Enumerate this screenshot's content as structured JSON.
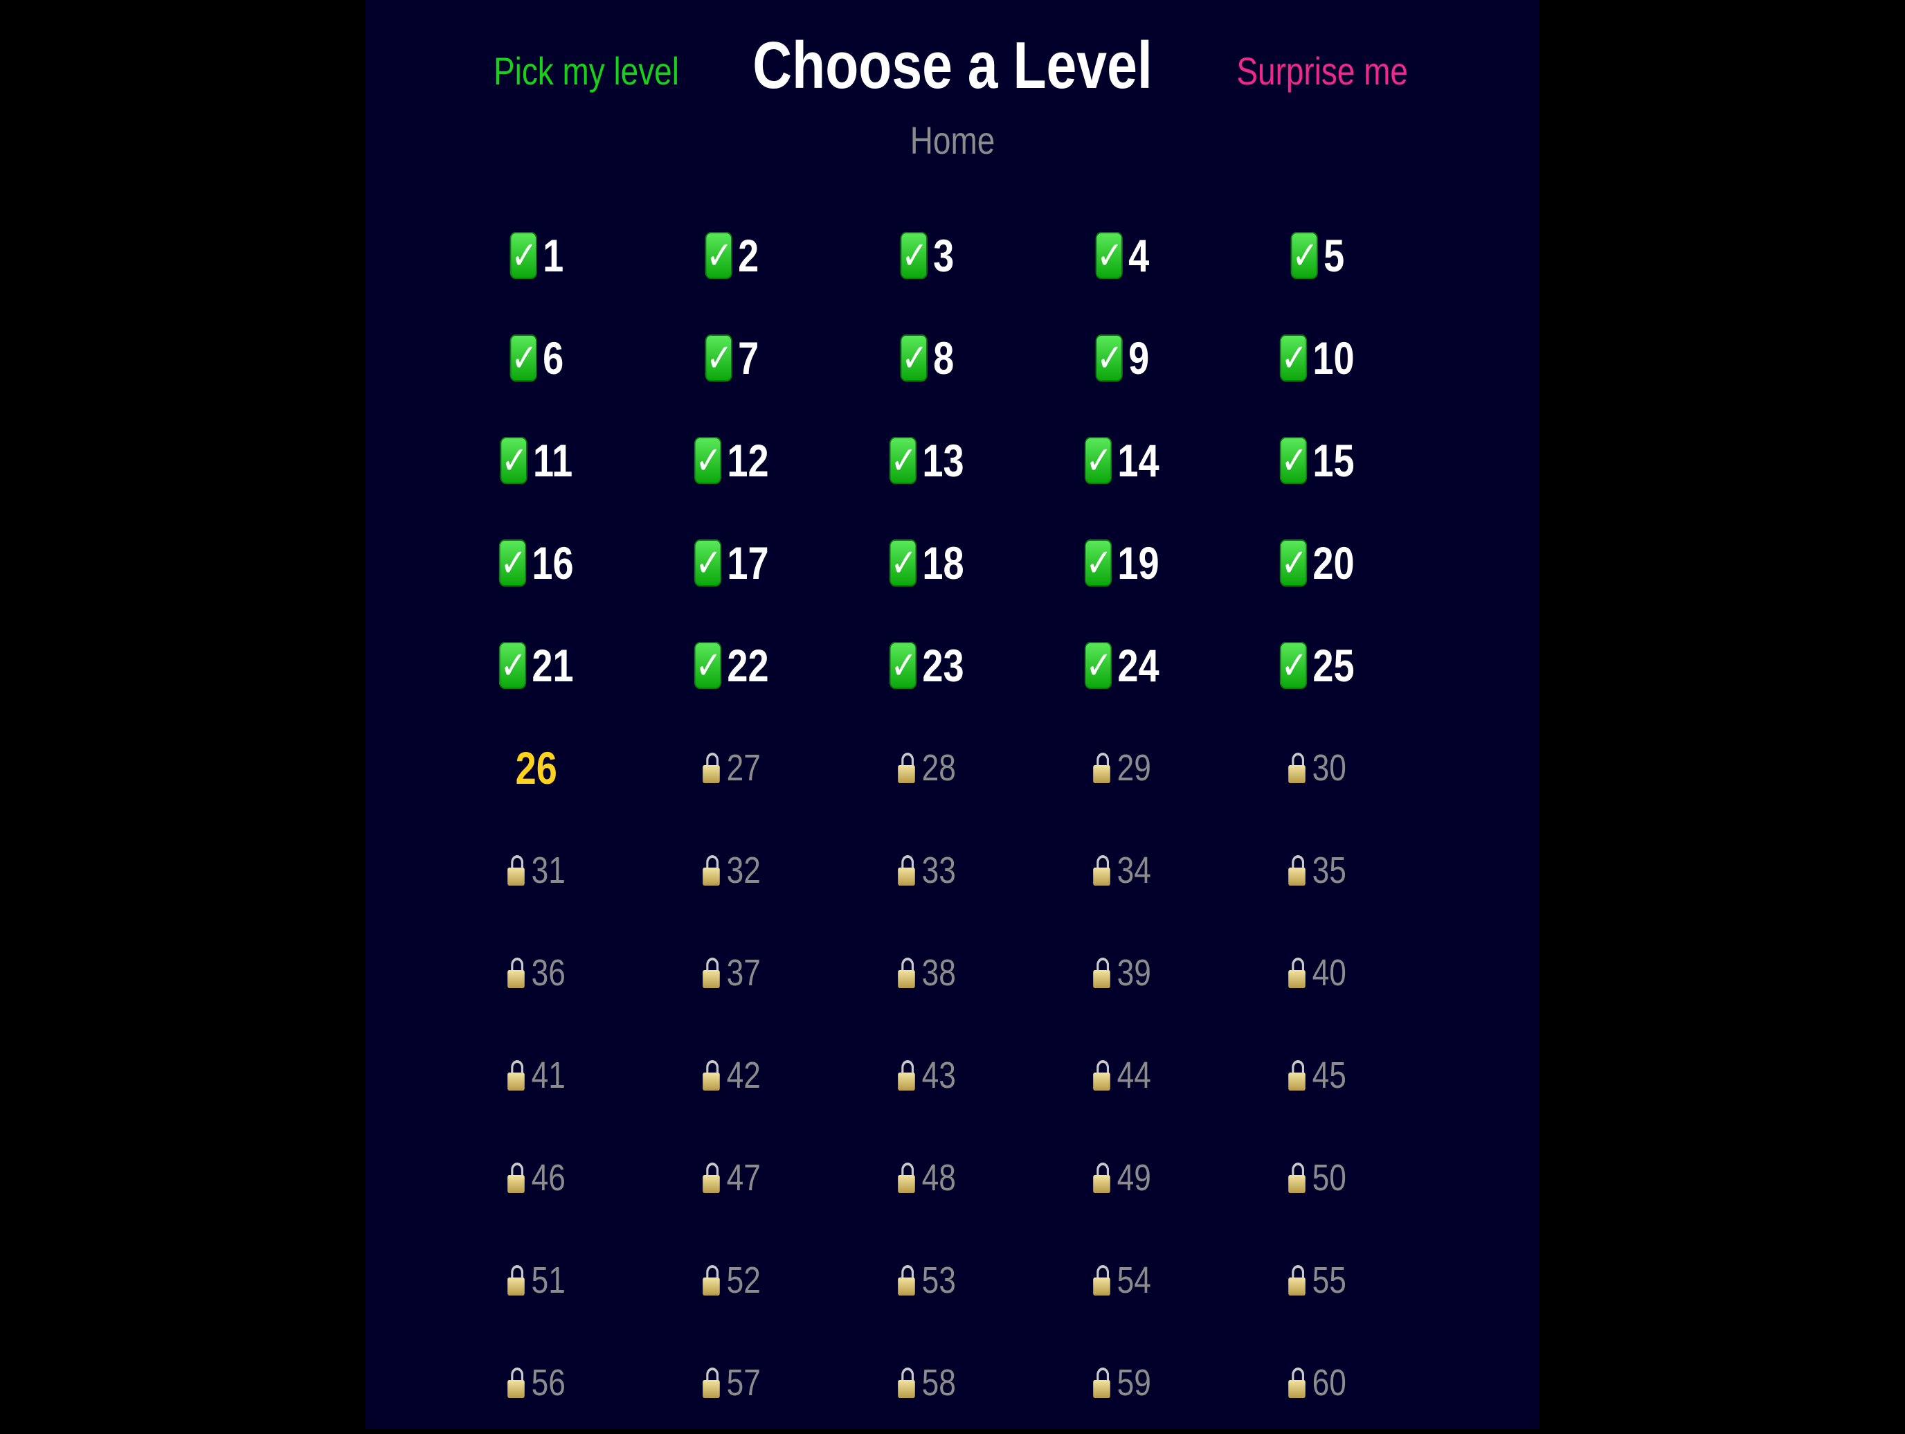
{
  "header": {
    "pick_label": "Pick my level",
    "title": "Choose a Level",
    "surprise_label": "Surprise me",
    "home_label": "Home"
  },
  "colors": {
    "background": "#000000",
    "panel": "#00002a",
    "pick": "#1ad11a",
    "surprise": "#f0288c",
    "title": "#ffffff",
    "home": "#8c8c8c",
    "current_level": "#ffd21e",
    "locked_level": "#8c8c8c"
  },
  "icons": {
    "completed": "check-mark-button-icon",
    "locked": "lock-icon"
  },
  "completed_glyph": "✓",
  "levels": [
    {
      "number": "1",
      "status": "completed"
    },
    {
      "number": "2",
      "status": "completed"
    },
    {
      "number": "3",
      "status": "completed"
    },
    {
      "number": "4",
      "status": "completed"
    },
    {
      "number": "5",
      "status": "completed"
    },
    {
      "number": "6",
      "status": "completed"
    },
    {
      "number": "7",
      "status": "completed"
    },
    {
      "number": "8",
      "status": "completed"
    },
    {
      "number": "9",
      "status": "completed"
    },
    {
      "number": "10",
      "status": "completed"
    },
    {
      "number": "11",
      "status": "completed"
    },
    {
      "number": "12",
      "status": "completed"
    },
    {
      "number": "13",
      "status": "completed"
    },
    {
      "number": "14",
      "status": "completed"
    },
    {
      "number": "15",
      "status": "completed"
    },
    {
      "number": "16",
      "status": "completed"
    },
    {
      "number": "17",
      "status": "completed"
    },
    {
      "number": "18",
      "status": "completed"
    },
    {
      "number": "19",
      "status": "completed"
    },
    {
      "number": "20",
      "status": "completed"
    },
    {
      "number": "21",
      "status": "completed"
    },
    {
      "number": "22",
      "status": "completed"
    },
    {
      "number": "23",
      "status": "completed"
    },
    {
      "number": "24",
      "status": "completed"
    },
    {
      "number": "25",
      "status": "completed"
    },
    {
      "number": "26",
      "status": "current"
    },
    {
      "number": "27",
      "status": "locked"
    },
    {
      "number": "28",
      "status": "locked"
    },
    {
      "number": "29",
      "status": "locked"
    },
    {
      "number": "30",
      "status": "locked"
    },
    {
      "number": "31",
      "status": "locked"
    },
    {
      "number": "32",
      "status": "locked"
    },
    {
      "number": "33",
      "status": "locked"
    },
    {
      "number": "34",
      "status": "locked"
    },
    {
      "number": "35",
      "status": "locked"
    },
    {
      "number": "36",
      "status": "locked"
    },
    {
      "number": "37",
      "status": "locked"
    },
    {
      "number": "38",
      "status": "locked"
    },
    {
      "number": "39",
      "status": "locked"
    },
    {
      "number": "40",
      "status": "locked"
    },
    {
      "number": "41",
      "status": "locked"
    },
    {
      "number": "42",
      "status": "locked"
    },
    {
      "number": "43",
      "status": "locked"
    },
    {
      "number": "44",
      "status": "locked"
    },
    {
      "number": "45",
      "status": "locked"
    },
    {
      "number": "46",
      "status": "locked"
    },
    {
      "number": "47",
      "status": "locked"
    },
    {
      "number": "48",
      "status": "locked"
    },
    {
      "number": "49",
      "status": "locked"
    },
    {
      "number": "50",
      "status": "locked"
    },
    {
      "number": "51",
      "status": "locked"
    },
    {
      "number": "52",
      "status": "locked"
    },
    {
      "number": "53",
      "status": "locked"
    },
    {
      "number": "54",
      "status": "locked"
    },
    {
      "number": "55",
      "status": "locked"
    },
    {
      "number": "56",
      "status": "locked"
    },
    {
      "number": "57",
      "status": "locked"
    },
    {
      "number": "58",
      "status": "locked"
    },
    {
      "number": "59",
      "status": "locked"
    },
    {
      "number": "60",
      "status": "locked"
    }
  ]
}
